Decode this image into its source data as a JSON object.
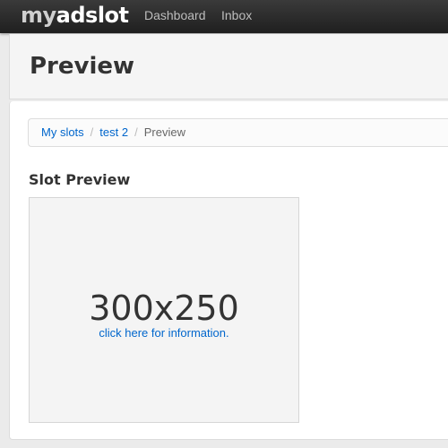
{
  "brand": {
    "my": "my",
    "rest": "adslot"
  },
  "nav": {
    "dashboard": "Dashboard",
    "inbox": "Inbox"
  },
  "page": {
    "title": "Preview"
  },
  "breadcrumb": {
    "items": [
      {
        "label": "My slots"
      },
      {
        "label": "test 2"
      }
    ],
    "separator": "/",
    "current": "Preview"
  },
  "section": {
    "title": "Slot Preview"
  },
  "slot": {
    "size": "300x250",
    "info": "click here for information."
  },
  "colors": {
    "topbar": "#2b2b2b",
    "link": "#0066cc",
    "panel": "#f5f5f5",
    "background": "#ebebeb"
  }
}
